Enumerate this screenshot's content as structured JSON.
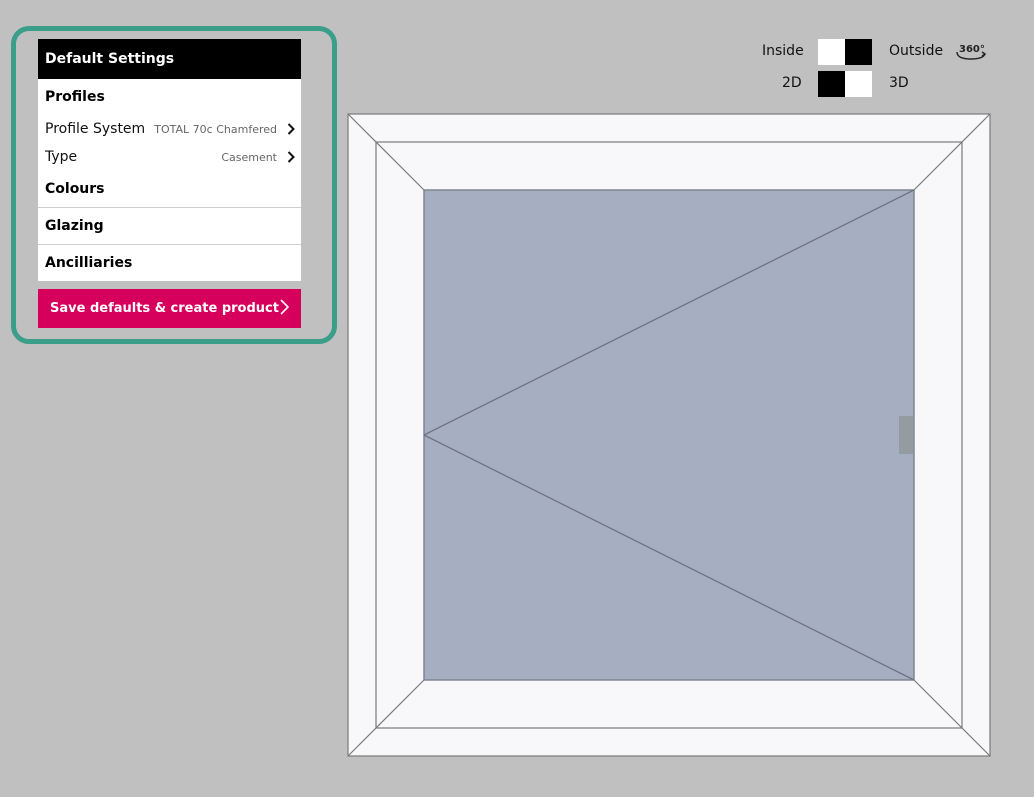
{
  "panel": {
    "header": "Default Settings",
    "profiles_label": "Profiles",
    "profile_system": {
      "label": "Profile System",
      "value": "TOTAL 70c Chamfered"
    },
    "type": {
      "label": "Type",
      "value": "Casement"
    },
    "colours_label": "Colours",
    "glazing_label": "Glazing",
    "ancillaries_label": "Ancilliaries",
    "save_button": "Save defaults & create product"
  },
  "view_controls": {
    "inside_label": "Inside",
    "outside_label": "Outside",
    "view_360_label": "360°",
    "d2_label": "2D",
    "d3_label": "3D"
  },
  "colors": {
    "accent": "#d6005c",
    "outline": "#3a9e88",
    "glass": "#a5afc1",
    "frame": "#f8f8fa"
  }
}
